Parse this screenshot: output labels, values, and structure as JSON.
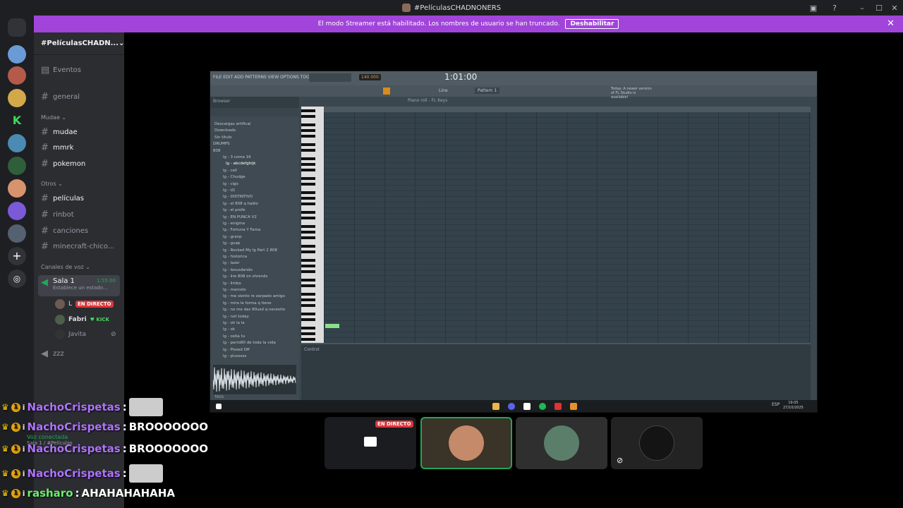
{
  "window": {
    "title": "#PelículasCHADNONERS"
  },
  "banner": {
    "text": "El modo Streamer está habilitado. Los nombres de usuario se han truncado.",
    "button": "Deshabilitar"
  },
  "guild": {
    "name": "#PelículasCHADN..."
  },
  "channels": {
    "eventos": "Eventos",
    "general": "general",
    "cat_mudae": "Mudae",
    "mudae": "mudae",
    "mmrk": "mmrk",
    "pokemon": "pokemon",
    "cat_otros": "Otros",
    "peliculas": "películas",
    "rinbot": "rinbot",
    "canciones": "canciones",
    "minecraft": "minecraft-chico...",
    "cat_voz": "Canales de voz",
    "sala1": "Sala 1",
    "sala1_time": "1:55:00",
    "sala1_status": "Establece un estado...",
    "zzz": "zzz"
  },
  "voice_users": [
    {
      "name": "L",
      "badge": "EN DIRECTO"
    },
    {
      "name": "Fabri",
      "tag": "KICK"
    },
    {
      "name": "Javita"
    }
  ],
  "fl": {
    "menu": "FILE EDIT ADD PATTERNS VIEW OPTIONS TOOLS HELP",
    "tempo": "140.000",
    "time": "1:01:00",
    "pattern": "Pattern 1",
    "line": "Line",
    "news": "Today: A newer version of FL Studio is available!",
    "browser_title": "Browser",
    "pianoroll_title": "Piano roll - FL Keys",
    "control": "Control",
    "tags": "TAGS",
    "clock": "19:05",
    "date": "27/10/2025",
    "lang": "ESP",
    "browser_items": [
      "Descargas artifical",
      "Downloads",
      "Sin título",
      "DRUMPS",
      "808",
      "lg - 3 coma 16",
      "lg - abcdefghijk",
      "lg - cell",
      "lg - Chudge",
      "lg - cigo",
      "lg - d1",
      "lg - DISTINTIVO",
      "lg - el 808 q hablo",
      "lg - el profe",
      "lg - EN PUNCA V2",
      "lg - enigma",
      "lg - Fortuna Y Fama",
      "lg - granp",
      "lg - guap",
      "lg - Rocked My lg Part 2 808",
      "lg - historica",
      "lg - lazei",
      "lg - lesusdando",
      "lg - lire 808 on shrends",
      "lg - limbo",
      "lg - marcelo",
      "lg - me siento re zarpado amigo",
      "lg - mira la forma q tiene",
      "lg - no me das 80usd q necesito",
      "lg - not today",
      "lg - oh la la",
      "lg - ok",
      "lg - ostia tu",
      "lg - perro80 de toda la vida",
      "lg - Pissed Off",
      "lg - plusssss"
    ]
  },
  "stream": {
    "live": "EN DIRECTO"
  },
  "chat": [
    {
      "user": "NachoCrispetas",
      "text": ""
    },
    {
      "user": "NachoCrispetas",
      "text": "BROOOOOOO"
    },
    {
      "user": "NachoCrispetas",
      "text": "BROOOOOOO"
    },
    {
      "user": "NachoCrispetas",
      "text": ""
    },
    {
      "user": "rasharo",
      "text": "AHAHAHAHAHA"
    }
  ],
  "voice_status": {
    "connected": "Voz conectada",
    "channel": "Sala 1 / #Películas"
  },
  "colors": {
    "banner": "#a144d9",
    "accent": "#5865f2",
    "live": "#da373c"
  }
}
